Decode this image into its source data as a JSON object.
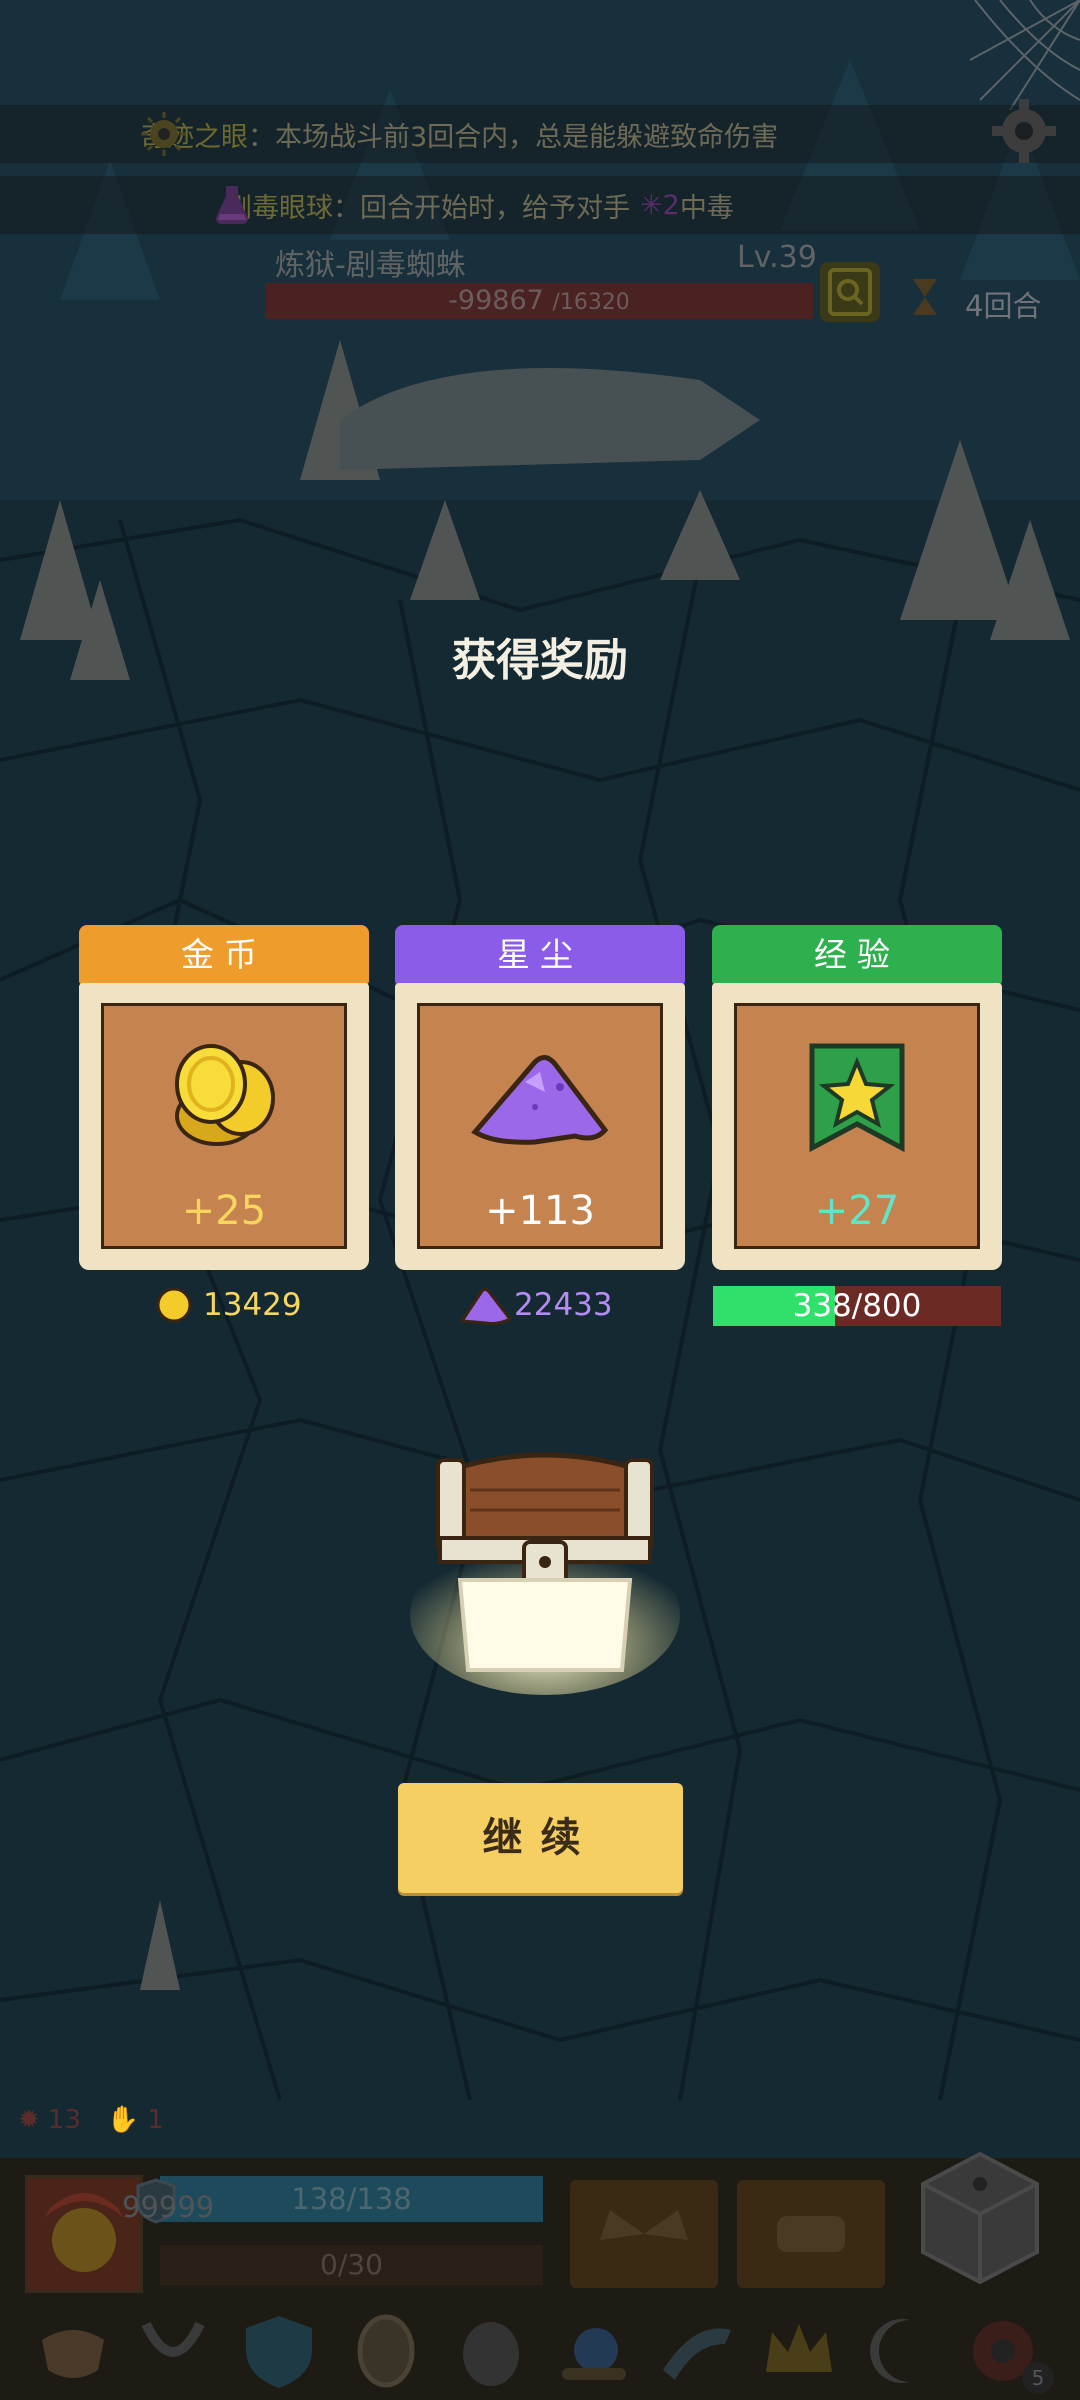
{
  "buffs": [
    {
      "name": "奇迹之眼",
      "desc": "：本场战斗前3回合内，总是能躲避致命伤害"
    },
    {
      "name": "剧毒眼球",
      "desc": "：回合开始时，给予对手",
      "count": "2",
      "effect": " 中毒"
    }
  ],
  "enemy": {
    "name": "炼狱-剧毒蜘蛛",
    "level": "Lv.39",
    "hp_current": "-99867",
    "hp_max": "/16320"
  },
  "round_label": "4回合",
  "reward_title": "获得奖励",
  "rewards": [
    {
      "label": "金币",
      "value": "+25",
      "total": "13429",
      "color": "#ee9c2c",
      "value_color": "#f6d65e"
    },
    {
      "label": "星尘",
      "value": "+113",
      "total": "22433",
      "color": "#8a5ce8",
      "value_color": "#ffffff"
    },
    {
      "label": "经验",
      "value": "+27",
      "total": "338/800",
      "color": "#2fb04e",
      "value_color": "#5ee6c8"
    }
  ],
  "exp_progress": 0.4225,
  "continue_label": "继续",
  "status_effects": [
    "13",
    "1"
  ],
  "hero": {
    "shield": "99999",
    "hp": "138/138",
    "shield_bar": "0/30"
  },
  "dice_badge": "5",
  "icons": {
    "settings": "gear-icon",
    "buff1": "eye-sun-icon",
    "buff2": "potion-icon",
    "search": "magnifier-icon",
    "round": "hourglass-icon",
    "gold": "coin-icon",
    "stardust": "stardust-pile-icon",
    "exp": "star-banner-icon",
    "chest": "treasure-chest-icon",
    "dice": "dice-icon"
  }
}
